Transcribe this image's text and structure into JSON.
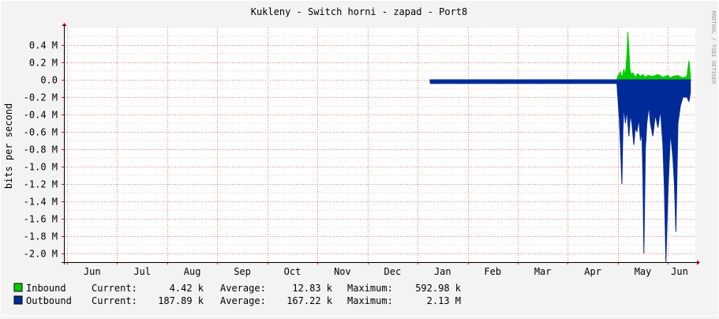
{
  "chart_data": {
    "type": "area",
    "title": "Kukleny - Switch horni - zapad - Port8",
    "ylabel": "bits per second",
    "watermark": "RRDTOOL / TOBI OETIKER",
    "ylim": [
      -2.1,
      0.6
    ],
    "y_ticks": [
      {
        "value": 0.4,
        "label": "0.4 M"
      },
      {
        "value": 0.2,
        "label": "0.2 M"
      },
      {
        "value": 0.0,
        "label": "0.0"
      },
      {
        "value": -0.2,
        "label": "-0.2 M"
      },
      {
        "value": -0.4,
        "label": "-0.4 M"
      },
      {
        "value": -0.6,
        "label": "-0.6 M"
      },
      {
        "value": -0.8,
        "label": "-0.8 M"
      },
      {
        "value": -1.0,
        "label": "-1.0 M"
      },
      {
        "value": -1.2,
        "label": "-1.2 M"
      },
      {
        "value": -1.4,
        "label": "-1.4 M"
      },
      {
        "value": -1.6,
        "label": "-1.6 M"
      },
      {
        "value": -1.8,
        "label": "-1.8 M"
      },
      {
        "value": -2.0,
        "label": "-2.0 M"
      }
    ],
    "x_range_months": [
      0,
      12.5
    ],
    "month_labels": [
      "Jun",
      "Jul",
      "Aug",
      "Sep",
      "Oct",
      "Nov",
      "Dec",
      "Jan",
      "Feb",
      "Mar",
      "Apr",
      "May",
      "Jun"
    ],
    "grid": true,
    "series": [
      {
        "name": "Inbound",
        "color": "#00cc00",
        "points": [
          [
            7.25,
            0.0
          ],
          [
            10.98,
            0.0
          ],
          [
            11.0,
            0.04
          ],
          [
            11.05,
            0.09
          ],
          [
            11.08,
            0.02
          ],
          [
            11.12,
            0.12
          ],
          [
            11.15,
            0.05
          ],
          [
            11.18,
            0.28
          ],
          [
            11.2,
            0.55
          ],
          [
            11.22,
            0.35
          ],
          [
            11.24,
            0.12
          ],
          [
            11.27,
            0.06
          ],
          [
            11.3,
            0.08
          ],
          [
            11.35,
            0.03
          ],
          [
            11.4,
            0.07
          ],
          [
            11.45,
            0.04
          ],
          [
            11.5,
            0.06
          ],
          [
            11.55,
            0.03
          ],
          [
            11.6,
            0.05
          ],
          [
            11.7,
            0.04
          ],
          [
            11.8,
            0.06
          ],
          [
            11.9,
            0.03
          ],
          [
            11.95,
            0.04
          ],
          [
            12.0,
            0.05
          ],
          [
            12.05,
            0.02
          ],
          [
            12.1,
            0.04
          ],
          [
            12.2,
            0.05
          ],
          [
            12.3,
            0.02
          ],
          [
            12.38,
            0.04
          ],
          [
            12.42,
            0.22
          ],
          [
            12.45,
            0.05
          ]
        ],
        "legend": {
          "current": "4.42 k",
          "average": "12.83 k",
          "maximum": "592.98 k"
        }
      },
      {
        "name": "Outbound",
        "color": "#002a97",
        "points": [
          [
            7.25,
            -0.03
          ],
          [
            7.5,
            -0.035
          ],
          [
            8.0,
            -0.03
          ],
          [
            8.5,
            -0.035
          ],
          [
            9.0,
            -0.03
          ],
          [
            9.5,
            -0.035
          ],
          [
            10.0,
            -0.03
          ],
          [
            10.5,
            -0.035
          ],
          [
            10.98,
            -0.035
          ],
          [
            11.0,
            -0.2
          ],
          [
            11.03,
            -0.45
          ],
          [
            11.06,
            -0.85
          ],
          [
            11.08,
            -1.2
          ],
          [
            11.1,
            -0.6
          ],
          [
            11.12,
            -0.3
          ],
          [
            11.15,
            -0.5
          ],
          [
            11.18,
            -0.35
          ],
          [
            11.22,
            -0.65
          ],
          [
            11.25,
            -0.4
          ],
          [
            11.28,
            -0.5
          ],
          [
            11.32,
            -0.75
          ],
          [
            11.35,
            -0.55
          ],
          [
            11.38,
            -0.6
          ],
          [
            11.42,
            -0.45
          ],
          [
            11.45,
            -0.7
          ],
          [
            11.48,
            -0.6
          ],
          [
            11.5,
            -1.1
          ],
          [
            11.52,
            -2.0
          ],
          [
            11.55,
            -0.8
          ],
          [
            11.58,
            -0.5
          ],
          [
            11.62,
            -0.3
          ],
          [
            11.65,
            -0.5
          ],
          [
            11.7,
            -0.65
          ],
          [
            11.75,
            -0.4
          ],
          [
            11.8,
            -0.55
          ],
          [
            11.85,
            -0.35
          ],
          [
            11.9,
            -0.75
          ],
          [
            11.93,
            -1.25
          ],
          [
            11.96,
            -2.1
          ],
          [
            12.0,
            -1.3
          ],
          [
            12.05,
            -0.6
          ],
          [
            12.1,
            -0.9
          ],
          [
            12.13,
            -1.2
          ],
          [
            12.16,
            -1.75
          ],
          [
            12.2,
            -0.5
          ],
          [
            12.25,
            -0.3
          ],
          [
            12.3,
            -0.2
          ],
          [
            12.38,
            -0.2
          ],
          [
            12.42,
            -0.25
          ],
          [
            12.45,
            -0.15
          ]
        ],
        "legend": {
          "current": "187.89 k",
          "average": "167.22 k",
          "maximum": "2.13 M"
        }
      }
    ],
    "legend_labels": {
      "current": "Current:",
      "average": "Average:",
      "maximum": "Maximum:"
    }
  }
}
